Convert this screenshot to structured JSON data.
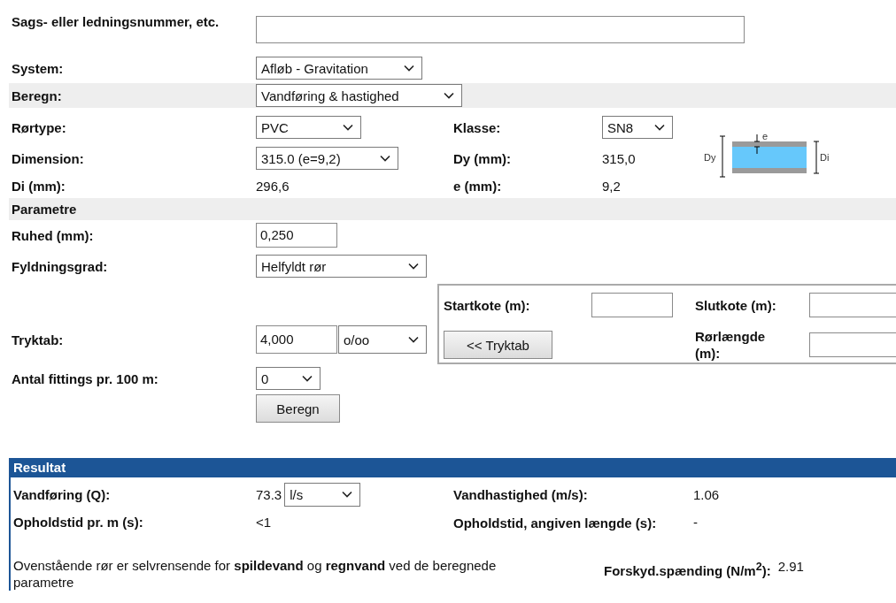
{
  "case": {
    "label": "Sags- eller ledningsnummer, etc."
  },
  "system": {
    "label": "System:",
    "value": "Afløb - Gravitation"
  },
  "calc": {
    "label": "Beregn:",
    "value": "Vandføring & hastighed"
  },
  "pipe": {
    "type_label": "Rørtype:",
    "type_value": "PVC",
    "class_label": "Klasse:",
    "class_value": "SN8",
    "dim_label": "Dimension:",
    "dim_value": "315.0 (e=9,2)",
    "dy_label": "Dy (mm):",
    "dy_value": "315,0",
    "di_label": "Di (mm):",
    "di_value": "296,6",
    "e_label": "e (mm):",
    "e_value": "9,2",
    "diagram": {
      "dy": "Dy",
      "di": "Di",
      "e": "e"
    }
  },
  "params": {
    "heading": "Parametre",
    "roughness_label": "Ruhed (mm):",
    "roughness_value": "0,250",
    "fill_label": "Fyldningsgrad:",
    "fill_value": "Helfyldt rør",
    "loss_label": "Tryktab:",
    "loss_value": "4,000",
    "loss_unit": "o/oo",
    "fittings_label": "Antal fittings pr. 100 m:",
    "fittings_value": "0",
    "button": "Beregn"
  },
  "loss_box": {
    "start_label": "Startkote (m):",
    "end_label": "Slutkote (m):",
    "button": "<< Tryktab",
    "length_label": "Rørlængde (m):"
  },
  "result": {
    "heading": "Resultat",
    "flow_label": "Vandføring (Q):",
    "flow_value": "73.3",
    "flow_unit": "l/s",
    "velocity_label": "Vandhastighed (m/s):",
    "velocity_value": "1.06",
    "time_label": "Opholdstid pr. m (s):",
    "time_value": "<1",
    "time_len_label": "Opholdstid, angiven længde (s):",
    "time_len_value": "-",
    "note": "Ovenstående rør er selvrensende for **spildevand** og **regnvand** ved de beregnede parametre",
    "shear_label": "Forskyd.spænding (N/m$^{2}$):",
    "shear_value": "2.91"
  }
}
